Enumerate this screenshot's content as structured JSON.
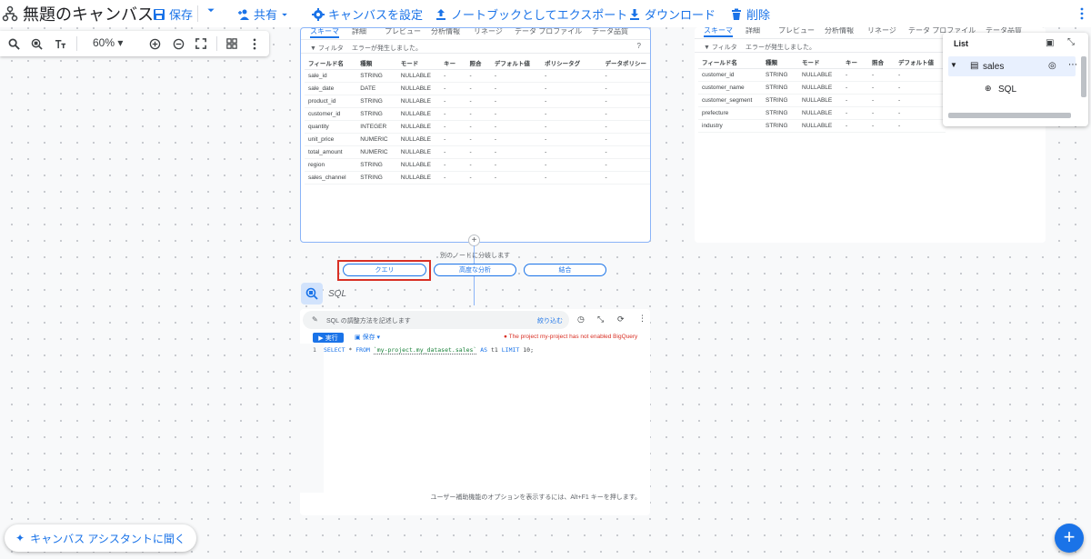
{
  "app": {
    "title": "無題のキャンバス",
    "toolbar": {
      "save": "保存",
      "share": "共有",
      "configure": "キャンバスを設定",
      "export": "ノートブックとしてエクスポート",
      "download": "ダウンロード",
      "delete": "削除"
    }
  },
  "zoom_toolbar": {
    "zoom_level": "60%"
  },
  "table_card_left": {
    "tabs": [
      "スキーマ",
      "詳細",
      "プレビュー",
      "分析情報",
      "リネージ",
      "データ プロファイル",
      "データ品質"
    ],
    "filter_label": "フィルタ",
    "filter_error": "エラーが発生しました。",
    "columns": [
      "フィールド名",
      "種類",
      "モード",
      "キー",
      "照合",
      "デフォルト値",
      "ポリシータグ",
      "データポリシー"
    ],
    "rows": [
      [
        "sale_id",
        "STRING",
        "NULLABLE",
        "-",
        "-",
        "-",
        "-",
        "-"
      ],
      [
        "sale_date",
        "DATE",
        "NULLABLE",
        "-",
        "-",
        "-",
        "-",
        "-"
      ],
      [
        "product_id",
        "STRING",
        "NULLABLE",
        "-",
        "-",
        "-",
        "-",
        "-"
      ],
      [
        "customer_id",
        "STRING",
        "NULLABLE",
        "-",
        "-",
        "-",
        "-",
        "-"
      ],
      [
        "quantity",
        "INTEGER",
        "NULLABLE",
        "-",
        "-",
        "-",
        "-",
        "-"
      ],
      [
        "unit_price",
        "NUMERIC",
        "NULLABLE",
        "-",
        "-",
        "-",
        "-",
        "-"
      ],
      [
        "total_amount",
        "NUMERIC",
        "NULLABLE",
        "-",
        "-",
        "-",
        "-",
        "-"
      ],
      [
        "region",
        "STRING",
        "NULLABLE",
        "-",
        "-",
        "-",
        "-",
        "-"
      ],
      [
        "sales_channel",
        "STRING",
        "NULLABLE",
        "-",
        "-",
        "-",
        "-",
        "-"
      ]
    ]
  },
  "table_card_right": {
    "tabs": [
      "スキーマ",
      "詳細",
      "プレビュー",
      "分析情報",
      "リネージ",
      "データ プロファイル",
      "データ品質"
    ],
    "filter_label": "フィルタ",
    "filter_error": "エラーが発生しました。",
    "columns": [
      "フィールド名",
      "種類",
      "モード",
      "キー",
      "照合",
      "デフォルト値"
    ],
    "rows": [
      [
        "customer_id",
        "STRING",
        "NULLABLE",
        "-",
        "-",
        "-"
      ],
      [
        "customer_name",
        "STRING",
        "NULLABLE",
        "-",
        "-",
        "-"
      ],
      [
        "customer_segment",
        "STRING",
        "NULLABLE",
        "-",
        "-",
        "-"
      ],
      [
        "prefecture",
        "STRING",
        "NULLABLE",
        "-",
        "-",
        "-"
      ],
      [
        "industry",
        "STRING",
        "NULLABLE",
        "-",
        "-",
        "-"
      ]
    ]
  },
  "branch": {
    "label": "別のノードに分岐します",
    "options": [
      "クエリ",
      "高度な分析",
      "結合"
    ]
  },
  "sql_node": {
    "label": "SQL",
    "prompt_placeholder": "SQL の調整方法を記述します",
    "refine": "絞り込む",
    "run": "実行",
    "save": "保存",
    "error": "The project my-project has not enabled BigQuery",
    "line_number": "1",
    "code": {
      "select": "SELECT",
      "star": "*",
      "from": "FROM",
      "table": "`my-project.my_dataset.sales`",
      "as": "AS",
      "alias": "t1",
      "limit": "LIMIT",
      "limit_value": "10;"
    },
    "accessibility_hint": "ユーザー補助機能のオプションを表示するには、Alt+F1 キーを押します。"
  },
  "list_panel": {
    "title": "List",
    "items": [
      {
        "label": "sales"
      },
      {
        "label": "SQL"
      }
    ]
  },
  "assistant": {
    "label": "キャンバス アシスタントに聞く"
  },
  "colors": {
    "accent": "#1a73e8",
    "error": "#d93025",
    "highlight_box": "#d93025"
  }
}
